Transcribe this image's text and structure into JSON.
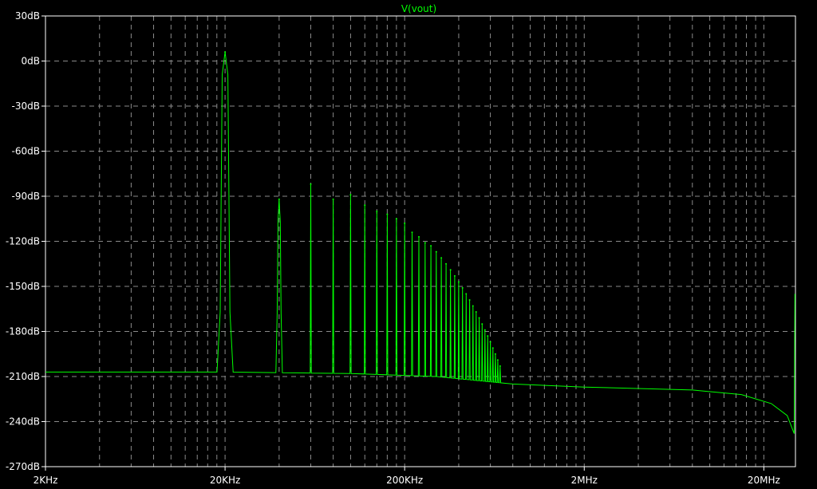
{
  "chart_data": {
    "type": "line",
    "title": "V(vout)",
    "xlabel": "",
    "ylabel": "",
    "x_scale": "log",
    "xlim": [
      2000,
      30000000
    ],
    "ylim": [
      -270,
      30
    ],
    "grid": true,
    "colors": {
      "background": "#000000",
      "trace": "#00ff00",
      "grid": "#8a8a8a",
      "text": "#ffffff"
    },
    "x_ticks": [
      {
        "value": 2000,
        "label": "2KHz"
      },
      {
        "value": 20000,
        "label": "20KHz"
      },
      {
        "value": 200000,
        "label": "200KHz"
      },
      {
        "value": 2000000,
        "label": "2MHz"
      },
      {
        "value": 20000000,
        "label": "20MHz"
      }
    ],
    "y_ticks": [
      {
        "value": 30,
        "label": "30dB"
      },
      {
        "value": 0,
        "label": "0dB"
      },
      {
        "value": -30,
        "label": "-30dB"
      },
      {
        "value": -60,
        "label": "-60dB"
      },
      {
        "value": -90,
        "label": "-90dB"
      },
      {
        "value": -120,
        "label": "-120dB"
      },
      {
        "value": -150,
        "label": "-150dB"
      },
      {
        "value": -180,
        "label": "-180dB"
      },
      {
        "value": -210,
        "label": "-210dB"
      },
      {
        "value": -240,
        "label": "-240dB"
      },
      {
        "value": -270,
        "label": "-270dB"
      }
    ],
    "series": [
      {
        "name": "V(vout)",
        "floor": [
          {
            "x": 2000,
            "y": -207
          },
          {
            "x": 19000,
            "y": -207
          },
          {
            "x": 100000,
            "y": -208
          },
          {
            "x": 300000,
            "y": -210
          },
          {
            "x": 800000,
            "y": -215
          },
          {
            "x": 2000000,
            "y": -217
          },
          {
            "x": 8000000,
            "y": -219
          },
          {
            "x": 15000000,
            "y": -222
          },
          {
            "x": 22000000,
            "y": -228
          },
          {
            "x": 27000000,
            "y": -236
          },
          {
            "x": 29500000,
            "y": -248
          }
        ],
        "peaks": [
          {
            "x": 20000,
            "y": 6,
            "width": 0.045
          },
          {
            "x": 40000,
            "y": -92,
            "width": 0.018
          },
          {
            "x": 60000,
            "y": -82
          },
          {
            "x": 80000,
            "y": -92
          },
          {
            "x": 100000,
            "y": -89
          },
          {
            "x": 120000,
            "y": -96
          },
          {
            "x": 140000,
            "y": -100
          },
          {
            "x": 160000,
            "y": -102
          },
          {
            "x": 180000,
            "y": -105
          },
          {
            "x": 200000,
            "y": -108
          },
          {
            "x": 220000,
            "y": -114
          },
          {
            "x": 240000,
            "y": -117
          },
          {
            "x": 260000,
            "y": -121
          },
          {
            "x": 280000,
            "y": -123
          },
          {
            "x": 300000,
            "y": -127
          },
          {
            "x": 320000,
            "y": -131
          },
          {
            "x": 340000,
            "y": -135
          },
          {
            "x": 360000,
            "y": -139
          },
          {
            "x": 380000,
            "y": -143
          },
          {
            "x": 400000,
            "y": -147
          },
          {
            "x": 420000,
            "y": -151
          },
          {
            "x": 440000,
            "y": -155
          },
          {
            "x": 460000,
            "y": -159
          },
          {
            "x": 480000,
            "y": -163
          },
          {
            "x": 500000,
            "y": -167
          },
          {
            "x": 520000,
            "y": -171
          },
          {
            "x": 540000,
            "y": -175
          },
          {
            "x": 560000,
            "y": -179
          },
          {
            "x": 580000,
            "y": -183
          },
          {
            "x": 600000,
            "y": -187
          },
          {
            "x": 620000,
            "y": -191
          },
          {
            "x": 640000,
            "y": -195
          },
          {
            "x": 660000,
            "y": -199
          },
          {
            "x": 680000,
            "y": -203
          }
        ],
        "end_spike": {
          "x": 29800000,
          "y": -155
        }
      }
    ]
  }
}
